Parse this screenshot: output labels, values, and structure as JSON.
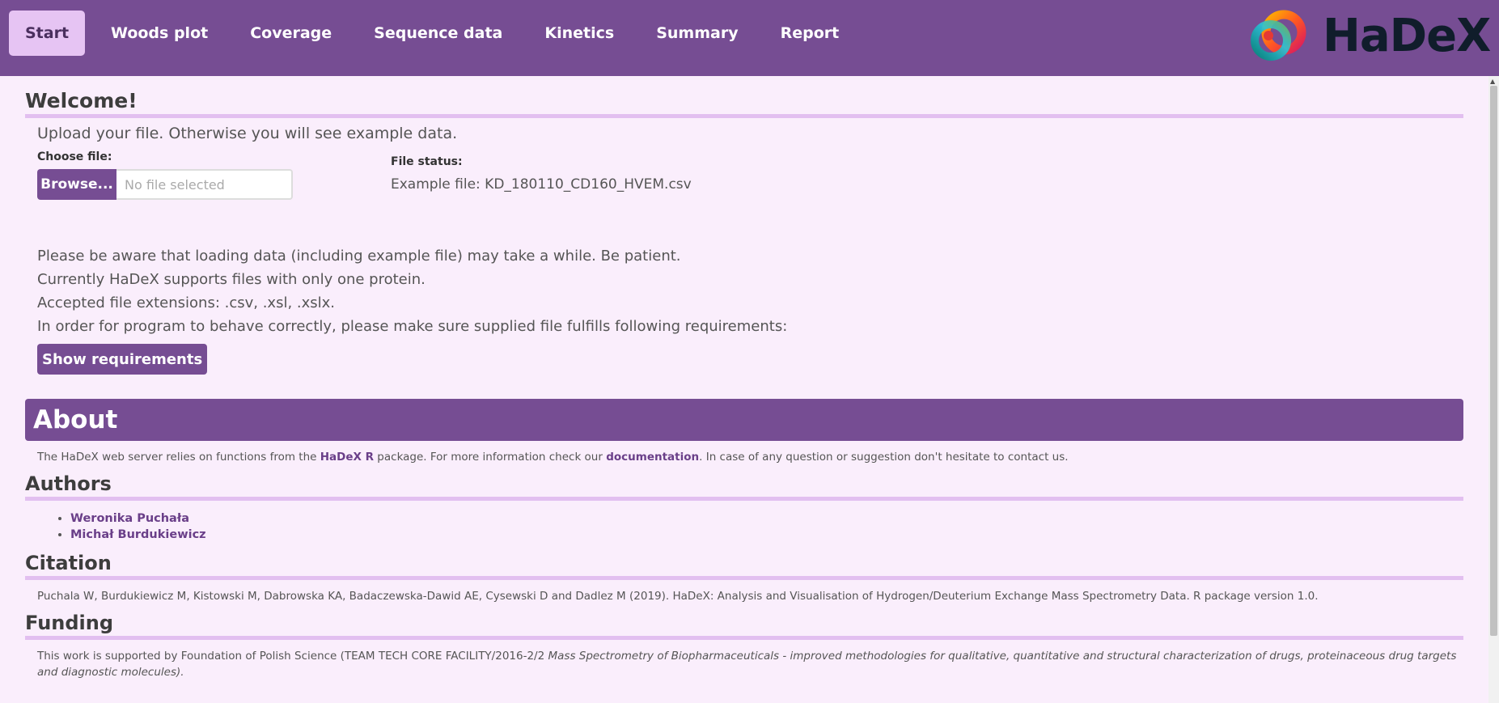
{
  "nav": {
    "tabs": [
      {
        "label": "Start",
        "active": true
      },
      {
        "label": "Woods plot"
      },
      {
        "label": "Coverage"
      },
      {
        "label": "Sequence data"
      },
      {
        "label": "Kinetics"
      },
      {
        "label": "Summary"
      },
      {
        "label": "Report"
      }
    ],
    "logo_text": "HaDeX"
  },
  "welcome": {
    "title": "Welcome!",
    "lead": "Upload your file. Otherwise you will see example data.",
    "choose_label": "Choose file:",
    "browse_label": "Browse...",
    "file_placeholder": "No file selected",
    "status_label": "File status:",
    "status_value": "Example file: KD_180110_CD160_HVEM.csv",
    "info": [
      "Please be aware that loading data (including example file) may take a while. Be patient.",
      "Currently HaDeX supports files with only one protein.",
      "Accepted file extensions: .csv, .xsl, .xslx.",
      "In order for program to behave correctly, please make sure supplied file fulfills following requirements:"
    ],
    "requirements_button": "Show requirements"
  },
  "about": {
    "title": "About",
    "text_1": "The HaDeX web server relies on functions from the ",
    "link_1": "HaDeX R",
    "text_2": " package. For more information check our ",
    "link_2": "documentation",
    "text_3": ". In case of any question or suggestion don't hesitate to contact us."
  },
  "authors": {
    "title": "Authors",
    "items": [
      "Weronika Puchała",
      "Michał Burdukiewicz"
    ]
  },
  "citation": {
    "title": "Citation",
    "text": "Puchala W, Burdukiewicz M, Kistowski M, Dabrowska KA, Badaczewska-Dawid AE, Cysewski D and Dadlez M (2019). HaDeX: Analysis and Visualisation of Hydrogen/Deuterium Exchange Mass Spectrometry Data. R package version 1.0."
  },
  "funding": {
    "title": "Funding",
    "text": "This work is supported by Foundation of Polish Science (TEAM TECH CORE FACILITY/2016-2/2 ",
    "italic": "Mass Spectrometry of Biopharmaceuticals - improved methodologies for qualitative, quantitative and structural characterization of drugs, proteinaceous drug targets and diagnostic molecules)."
  },
  "colors": {
    "navbar": "#764d93",
    "active_tab": "#e6c4f3",
    "page_bg": "#faeefc",
    "accent_line": "#e2bff0"
  }
}
